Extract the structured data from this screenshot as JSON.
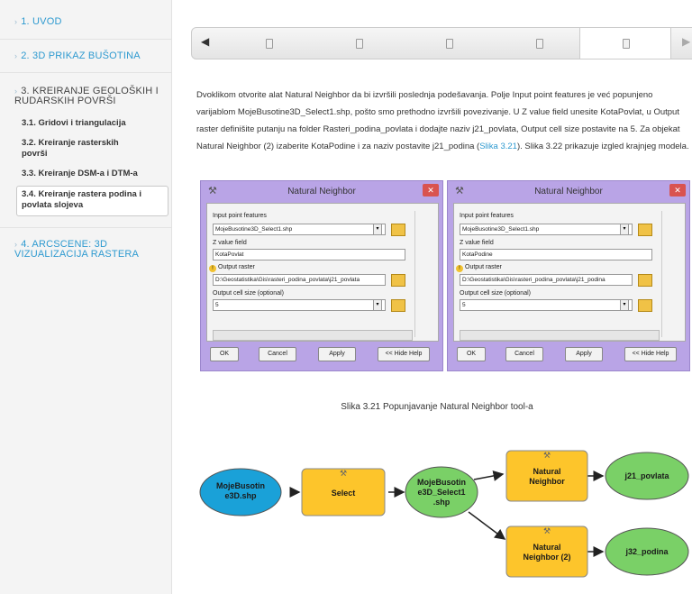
{
  "sidebar": {
    "items": [
      {
        "label": "1. UVOD"
      },
      {
        "label": "2. 3D PRIKAZ BUŠOTINA"
      },
      {
        "label": "3. KREIRANJE GEOLOŠKIH I RUDARSKIH POVRŠI"
      },
      {
        "label": "4. ARCSCENE: 3D VIZUALIZACIJA RASTERA"
      }
    ],
    "subitems": [
      {
        "label": "3.1. Gridovi i triangulacija"
      },
      {
        "label": "3.2. Kreiranje rasterskih površi"
      },
      {
        "label": "3.3. Kreiranje DSM-a i DTM-a"
      },
      {
        "label": "3.4. Kreiranje rastera podina i povlata slojeva"
      }
    ]
  },
  "slider": {
    "left_arrow": "◀",
    "right_arrow": "▶"
  },
  "content": {
    "paragraph_a": "Dvoklikom otvorite alat Natural Neighbor da bi izvršili poslednja podešavanja. Polje Input point features je već popunjeno varijablom MojeBusotine3D_Select1.shp, pošto smo prethodno izvršili povezivanje. U Z value field unesite KotaPovlat, u Output raster definišite putanju na folder Rasteri_podina_povlata i dodajte naziv j21_povlata, Output cell size postavite na 5. Za objekat Natural Neighbor (2) izaberite KotaPodine i za naziv postavite j21_podina (",
    "link": "Slika 3.21",
    "paragraph_b": "). Slika 3.22 prikazuje izgled krajnjeg modela.",
    "caption": "Slika 3.21 Popunjavanje Natural Neighbor tool-a"
  },
  "dialogs": [
    {
      "title": "Natural Neighbor",
      "input_label": "Input point features",
      "input_value": "MojeBusotine3D_Select1.shp",
      "z_label": "Z value field",
      "z_value": "KotaPovlat",
      "output_label": "Output raster",
      "output_value": "D:\\Geostatistika\\Gis\\rasteri_podina_povlata\\j21_povlata",
      "cell_label": "Output cell size (optional)",
      "cell_value": "5",
      "ok": "OK",
      "cancel": "Cancel",
      "apply": "Apply",
      "help": "<< Hide Help"
    },
    {
      "title": "Natural Neighbor",
      "input_label": "Input point features",
      "input_value": "MojeBusotine3D_Select1.shp",
      "z_label": "Z value field",
      "z_value": "KotaPodine",
      "output_label": "Output raster",
      "output_value": "D:\\Geostatistika\\Gis\\rasteri_podina_povlata\\j21_podina",
      "cell_label": "Output cell size (optional)",
      "cell_value": "5",
      "ok": "OK",
      "cancel": "Cancel",
      "apply": "Apply",
      "help": "<< Hide Help"
    }
  ],
  "model": {
    "nodes": {
      "input": [
        "MojeBusotin",
        "e3D.shp"
      ],
      "select": [
        "Select"
      ],
      "selected": [
        "MojeBusotin",
        "e3D_Select1",
        ".shp"
      ],
      "nn1": [
        "Natural",
        "Neighbor"
      ],
      "nn2": [
        "Natural",
        "Neighbor (2)"
      ],
      "out1": [
        "j21_povlata"
      ],
      "out2": [
        "j32_podina"
      ]
    },
    "colors": {
      "blue": "#1aa1d8",
      "yellow": "#fdc52b",
      "green": "#7ad067"
    }
  }
}
